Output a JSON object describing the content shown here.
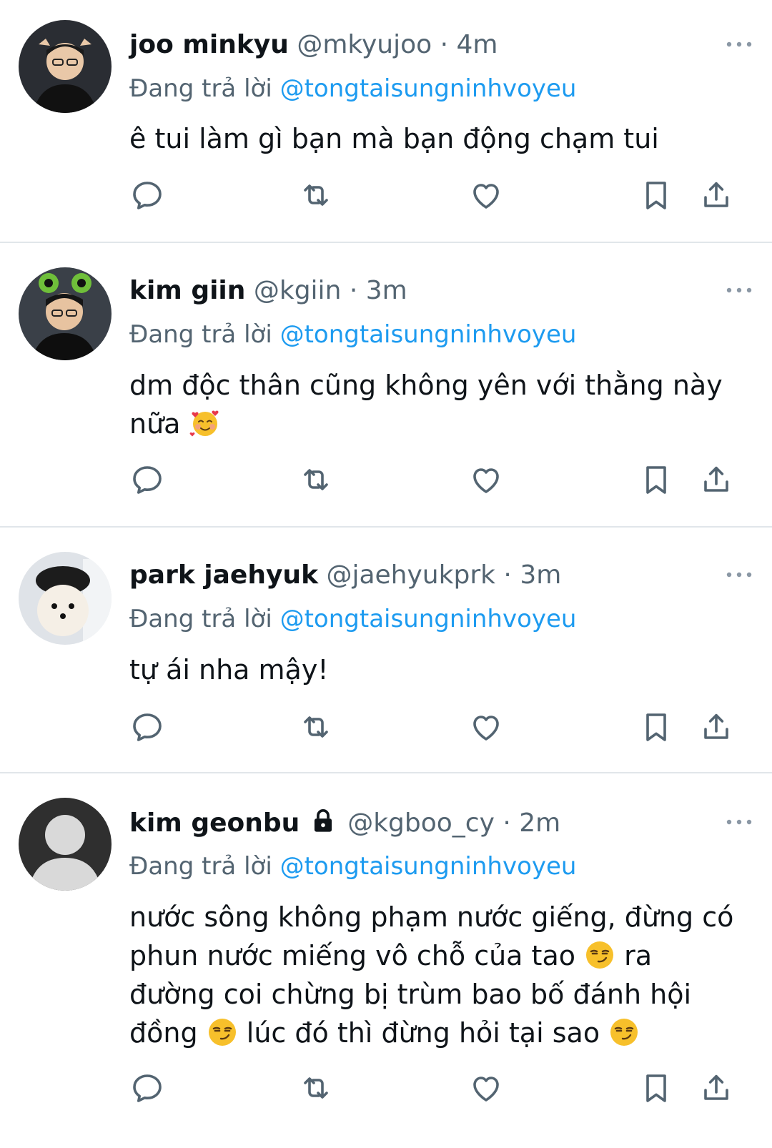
{
  "colors": {
    "mention": "#1d9bf0",
    "secondary": "#536471",
    "text": "#0f1419",
    "divider": "#e1e6ea"
  },
  "tweets": [
    {
      "name": "joo minkyu",
      "handle": "@mkyujoo",
      "separator": "·",
      "time": "4m",
      "replying_prefix": "Đang trả lời",
      "replying_to": "@tongtaisungninhvoyeu",
      "text_parts": [
        "ê tui làm gì bạn mà bạn động chạm tui"
      ]
    },
    {
      "name": "kim giin",
      "handle": "@kgiin",
      "separator": "·",
      "time": "3m",
      "replying_prefix": "Đang trả lời",
      "replying_to": "@tongtaisungninhvoyeu",
      "text_parts": [
        "dm độc thân cũng không yên với thằng này nữa"
      ],
      "emoji": "smiling-face-with-hearts"
    },
    {
      "name": "park jaehyuk",
      "handle": "@jaehyukprk",
      "separator": "·",
      "time": "3m",
      "replying_prefix": "Đang trả lời",
      "replying_to": "@tongtaisungninhvoyeu",
      "text_parts": [
        "tự ái nha mậy!"
      ]
    },
    {
      "name": "kim geonbu",
      "handle": "@kgboo_cy",
      "separator": "·",
      "time": "2m",
      "replying_prefix": "Đang trả lời",
      "replying_to": "@tongtaisungninhvoyeu",
      "text_parts": [
        "nước sông không phạm nước giếng, đừng có phun nước miếng vô chỗ của tao",
        "ra đường coi chừng bị trùm bao bố đánh hội đồng",
        "lúc đó thì đừng hỏi tại sao"
      ],
      "emoji": "smirking-face",
      "locked": true
    }
  ],
  "icons": {
    "reply": "reply-icon",
    "retweet": "retweet-icon",
    "like": "heart-icon",
    "bookmark": "bookmark-icon",
    "share": "share-icon",
    "more": "more-icon",
    "lock": "lock-icon"
  }
}
